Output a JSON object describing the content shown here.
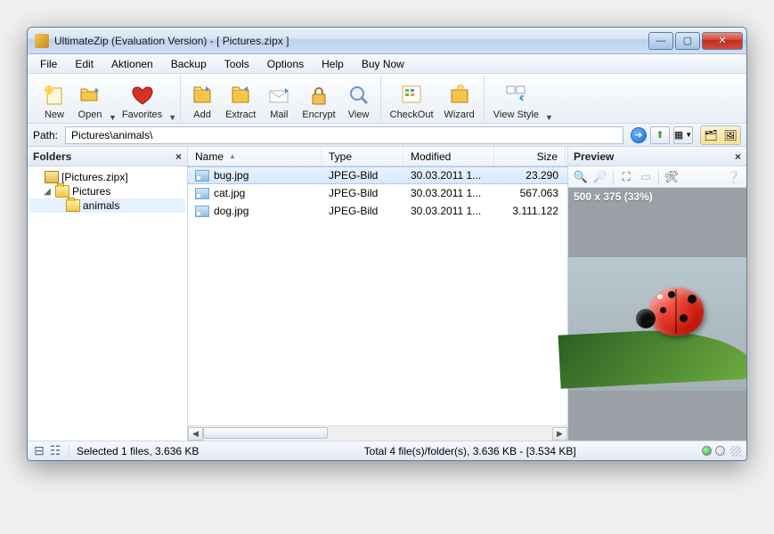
{
  "window": {
    "title": "UltimateZip (Evaluation Version) - [ Pictures.zipx ]"
  },
  "menu": {
    "items": [
      "File",
      "Edit",
      "Aktionen",
      "Backup",
      "Tools",
      "Options",
      "Help",
      "Buy Now"
    ]
  },
  "toolbar": {
    "groups": [
      [
        "New",
        "Open",
        "Favorites"
      ],
      [
        "Add",
        "Extract",
        "Mail",
        "Encrypt",
        "View"
      ],
      [
        "CheckOut",
        "Wizard"
      ],
      [
        "View Style"
      ]
    ]
  },
  "path": {
    "label": "Path:",
    "value": "Pictures\\animals\\"
  },
  "folders": {
    "title": "Folders",
    "root": "[Pictures.zipx]",
    "children": [
      {
        "name": "Pictures",
        "children": [
          {
            "name": "animals"
          }
        ]
      }
    ]
  },
  "list": {
    "columns": {
      "name": "Name",
      "type": "Type",
      "modified": "Modified",
      "size": "Size"
    },
    "rows": [
      {
        "name": "bug.jpg",
        "type": "JPEG-Bild",
        "modified": "30.03.2011 1...",
        "size": "23.290",
        "selected": true
      },
      {
        "name": "cat.jpg",
        "type": "JPEG-Bild",
        "modified": "30.03.2011 1...",
        "size": "567.063"
      },
      {
        "name": "dog.jpg",
        "type": "JPEG-Bild",
        "modified": "30.03.2011 1...",
        "size": "3.111.122"
      }
    ]
  },
  "preview": {
    "title": "Preview",
    "info": "500 x 375 (33%)"
  },
  "status": {
    "selected": "Selected 1 files, 3.636 KB",
    "total": "Total 4 file(s)/folder(s), 3.636 KB - [3.534 KB]"
  }
}
